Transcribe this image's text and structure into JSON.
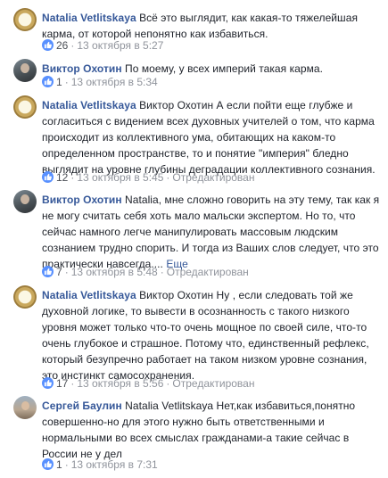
{
  "comments": [
    {
      "author": "Natalia Vetlitskaya",
      "text": "Всё это выглядит, как какая-то тяжелейшая карма, от которой непонятно как избавиться.",
      "likes": "26",
      "timestamp": "13 октября в 5:27",
      "edited": "",
      "more": ""
    },
    {
      "author": "Виктор Охотин",
      "text": "По моему, у всех империй такая карма.",
      "likes": "1",
      "timestamp": "13 октября в 5:34",
      "edited": "",
      "more": ""
    },
    {
      "author": "Natalia Vetlitskaya",
      "text": "Виктор Охотин А если пойти еще глубже и согласиться с видением всех духовных учителей о том, что карма происходит из коллективного ума, обитающих на каком-то определенном пространстве, то и понятие \"империя\" бледно выглядит на уровне глубины деградации коллективного сознания.",
      "likes": "12",
      "timestamp": "13 октября в 5:45",
      "edited": "Отредактирован",
      "more": ""
    },
    {
      "author": "Виктор Охотин",
      "text": "Natalia, мне сложно говорить на эту тему, так как я не могу считать себя хоть мало мальски экспертом. Но то, что сейчас намного легче манипулировать массовым людским сознанием трудно спорить. И тогда из Ваших слов следует, что это практически навсегда....",
      "likes": "7",
      "timestamp": "13 октября в 5:48",
      "edited": "Отредактирован",
      "more": "Еще"
    },
    {
      "author": "Natalia Vetlitskaya",
      "text": "Виктор Охотин Ну , если следовать той же духовной логике, то вывести в осознанность с такого низкого уровня может только что-то очень мощное по своей силе, что-то очень глубокое и страшное. Потому что, единственный рефлекс, который безупречно работает на таком низком уровне сознания, это инстинкт самосохранения.",
      "likes": "17",
      "timestamp": "13 октября в 5:56",
      "edited": "Отредактирован",
      "more": ""
    },
    {
      "author": "Сергей Баулин",
      "text": "Natalia Vetlitskaya Нет,как избавиться,понятно совершенно-но для этого нужно быть ответственными и нормальными во всех смыслах гражданами-а такие сейчас в России не у дел",
      "likes": "1",
      "timestamp": "13 октября в 7:31",
      "edited": "",
      "more": ""
    }
  ],
  "icons": {
    "like": "like-thumb-icon"
  },
  "colors": {
    "author": "#365899",
    "meta": "#90949c",
    "like_badge": "#5890ff"
  }
}
